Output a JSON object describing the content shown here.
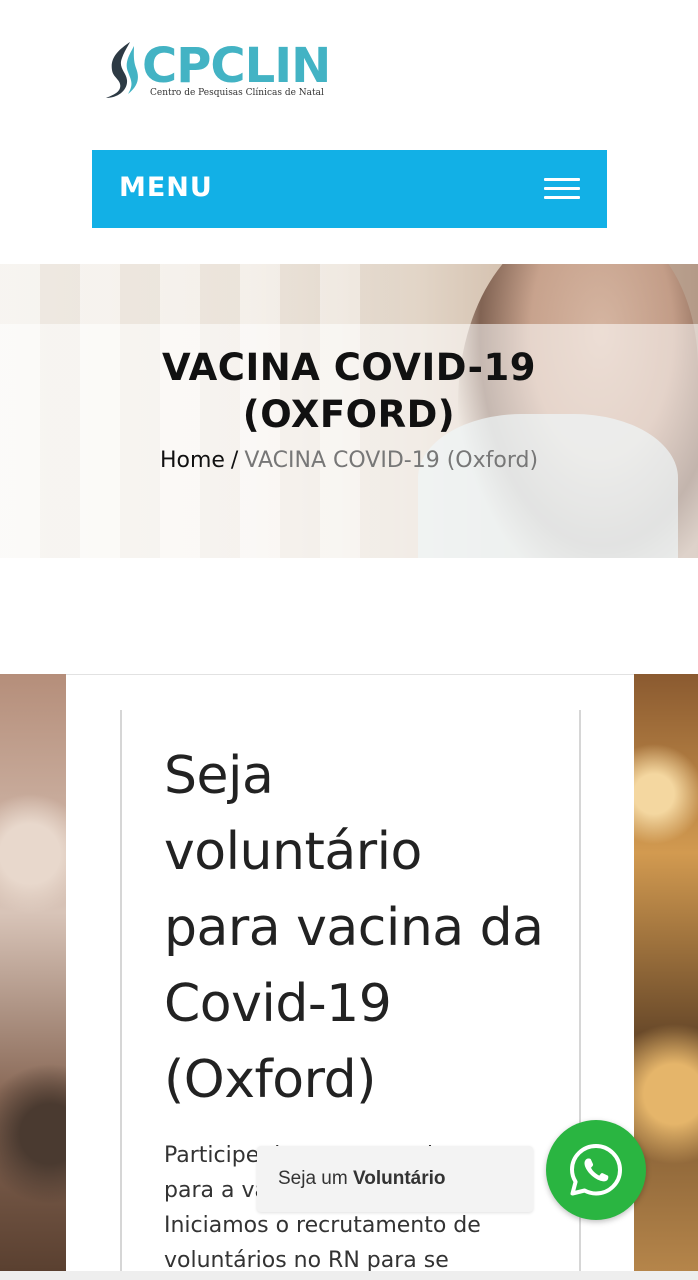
{
  "logo": {
    "name": "CPCLIN",
    "tagline": "Centro de Pesquisas Clínicas de Natal"
  },
  "menu": {
    "label": "MENU"
  },
  "hero": {
    "title_line1": "VACINA COVID-19",
    "title_line2": "(OXFORD)",
    "breadcrumb": {
      "home": "Home",
      "separator": "/",
      "current": "VACINA COVID-19 (Oxford)"
    }
  },
  "content": {
    "heading_lines": [
      "Seja",
      "voluntário",
      "para vacina da",
      "Covid-19",
      "(Oxford)"
    ],
    "paragraph_lines": [
      "Participe do nosso estudo.",
      "para a vacina de Oxford.",
      "Iniciamos o recrutamento de",
      "voluntários no RN para se"
    ]
  },
  "whatsapp": {
    "tooltip_prefix": "Seja um",
    "tooltip_bold": "Voluntário"
  },
  "colors": {
    "accent": "#12b0e6",
    "logo": "#43b3c4",
    "whatsapp": "#2ab541"
  },
  "icons": {
    "menu": "hamburger-icon",
    "whatsapp": "whatsapp-icon",
    "logo_mark": "flame-logo-icon"
  }
}
